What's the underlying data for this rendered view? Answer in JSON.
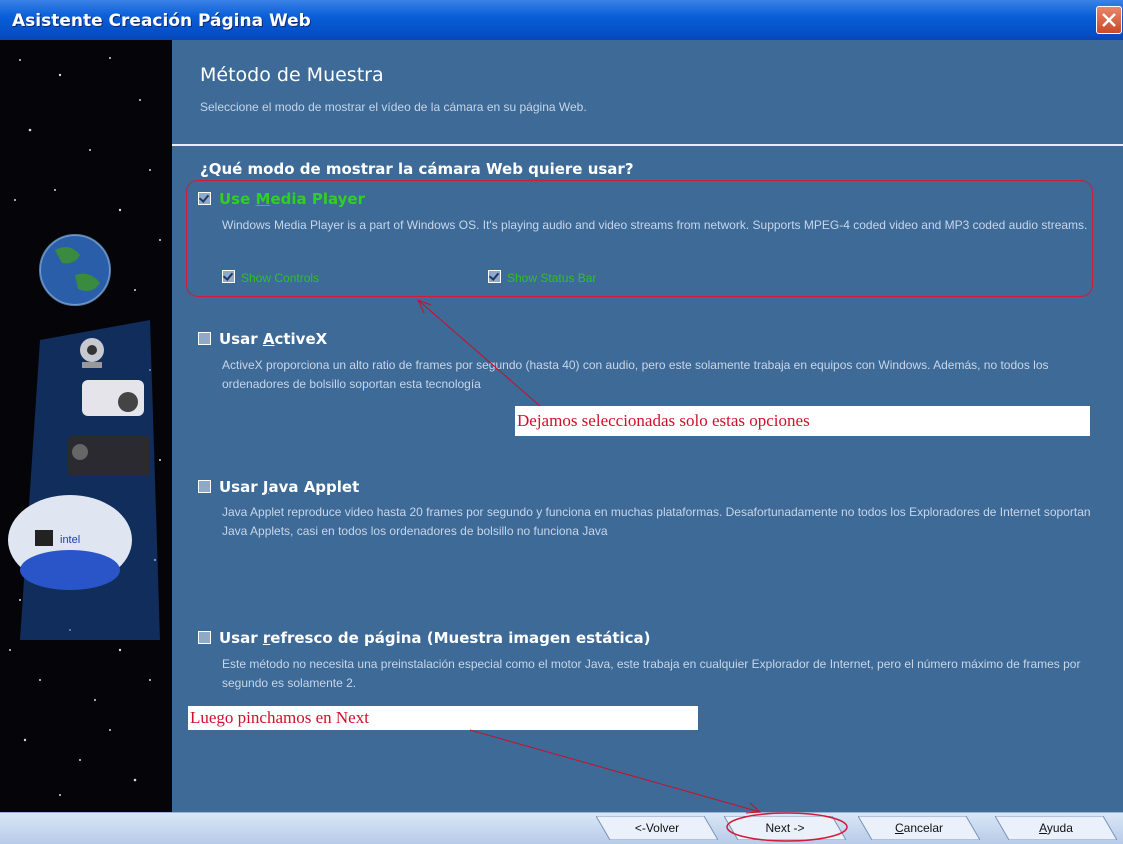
{
  "window": {
    "title": "Asistente Creación Página Web"
  },
  "header": {
    "title": "Método de Muestra",
    "subtitle": "Seleccione el modo de mostrar el vídeo de la cámara en su página Web."
  },
  "question": "¿Qué modo de mostrar la cámara Web quiere usar?",
  "options": [
    {
      "prefix": "Use ",
      "hotkey": "M",
      "rest": "edia Player",
      "description": "Windows Media Player is a part of Windows OS. It's playing audio and video streams from network. Supports MPEG-4 coded video and MP3 coded audio streams.",
      "checked": true
    },
    {
      "prefix": "Usar ",
      "hotkey": "A",
      "rest": "ctiveX",
      "description": "ActiveX proporciona un alto ratio de frames por segundo (hasta 40) con audio, pero este solamente trabaja en equipos con Windows. Además, no todos los ordenadores de bolsillo soportan esta tecnología",
      "checked": false
    },
    {
      "prefix": "Usar ",
      "hotkey": "J",
      "rest": "ava Applet",
      "description": "Java Applet reproduce video hasta 20 frames por segundo y funciona en muchas plataformas. Desafortunadamente no todos los Exploradores de Internet soportan Java Applets, casi en todos los ordenadores de bolsillo no funciona Java",
      "checked": false
    },
    {
      "prefix": "Usar ",
      "hotkey": "r",
      "rest": "efresco de página (Muestra imagen estática)",
      "description": "Este método no necesita una preinstalación especial como el motor Java, este trabaja en cualquier Explorador de Internet, pero el número máximo de frames por segundo es solamente 2.",
      "checked": false
    }
  ],
  "suboptions": {
    "show_controls": "Show Controls",
    "show_status_bar": "Show Status Bar"
  },
  "annotations": {
    "note1": "Dejamos seleccionadas solo estas opciones",
    "note2": "Luego pinchamos en Next"
  },
  "buttons": {
    "back": "<-Volver",
    "next": "Next ->",
    "cancel_hotkey": "C",
    "cancel_rest": "ancelar",
    "help_hotkey": "A",
    "help_rest": "yuda"
  },
  "logo_text": "intel",
  "colors": {
    "panel": "#3d6a97",
    "accent_green": "#30d020",
    "annotation_red": "#d0102a"
  }
}
